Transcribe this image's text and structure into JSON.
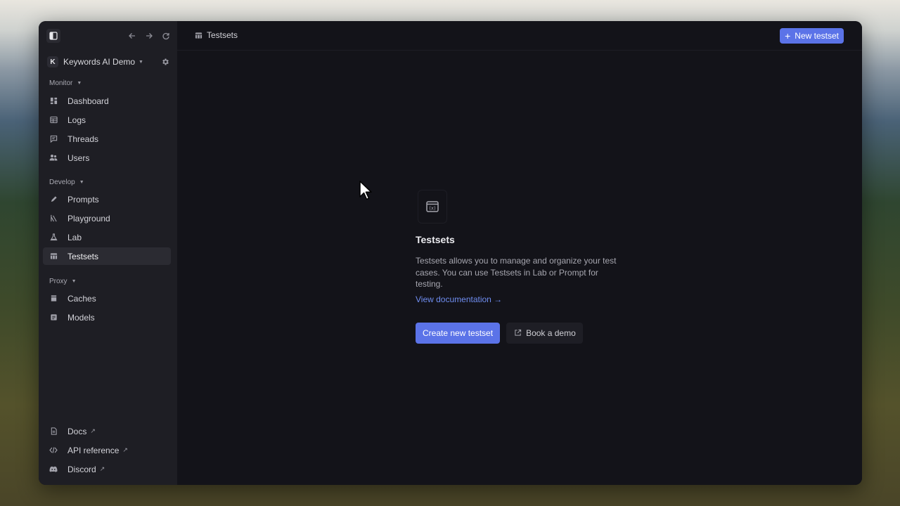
{
  "org": {
    "initial": "K",
    "name": "Keywords AI Demo"
  },
  "sidebar": {
    "sections": [
      {
        "title": "Monitor",
        "items": [
          {
            "label": "Dashboard",
            "icon": "dashboard-icon"
          },
          {
            "label": "Logs",
            "icon": "table-icon"
          },
          {
            "label": "Threads",
            "icon": "chat-icon"
          },
          {
            "label": "Users",
            "icon": "users-icon"
          }
        ]
      },
      {
        "title": "Develop",
        "items": [
          {
            "label": "Prompts",
            "icon": "pencil-icon"
          },
          {
            "label": "Playground",
            "icon": "playground-icon"
          },
          {
            "label": "Lab",
            "icon": "flask-icon"
          },
          {
            "label": "Testsets",
            "icon": "testsets-icon",
            "active": true
          }
        ]
      },
      {
        "title": "Proxy",
        "items": [
          {
            "label": "Caches",
            "icon": "cache-icon"
          },
          {
            "label": "Models",
            "icon": "models-icon"
          }
        ]
      }
    ],
    "footer": [
      {
        "label": "Docs",
        "icon": "doc-icon"
      },
      {
        "label": "API reference",
        "icon": "code-icon"
      },
      {
        "label": "Discord",
        "icon": "discord-icon"
      }
    ]
  },
  "header": {
    "breadcrumb": "Testsets",
    "new_button": "New testset"
  },
  "empty_state": {
    "title": "Testsets",
    "description": "Testsets allows you to manage and organize your test cases. You can use Testsets in Lab or Prompt for testing.",
    "link": "View documentation →",
    "primary_button": "Create new testset",
    "secondary_button": "Book a demo"
  },
  "colors": {
    "accent": "#5b73e8",
    "background": "#131319",
    "sidebar": "#1e1e24",
    "link": "#6f8df0"
  }
}
